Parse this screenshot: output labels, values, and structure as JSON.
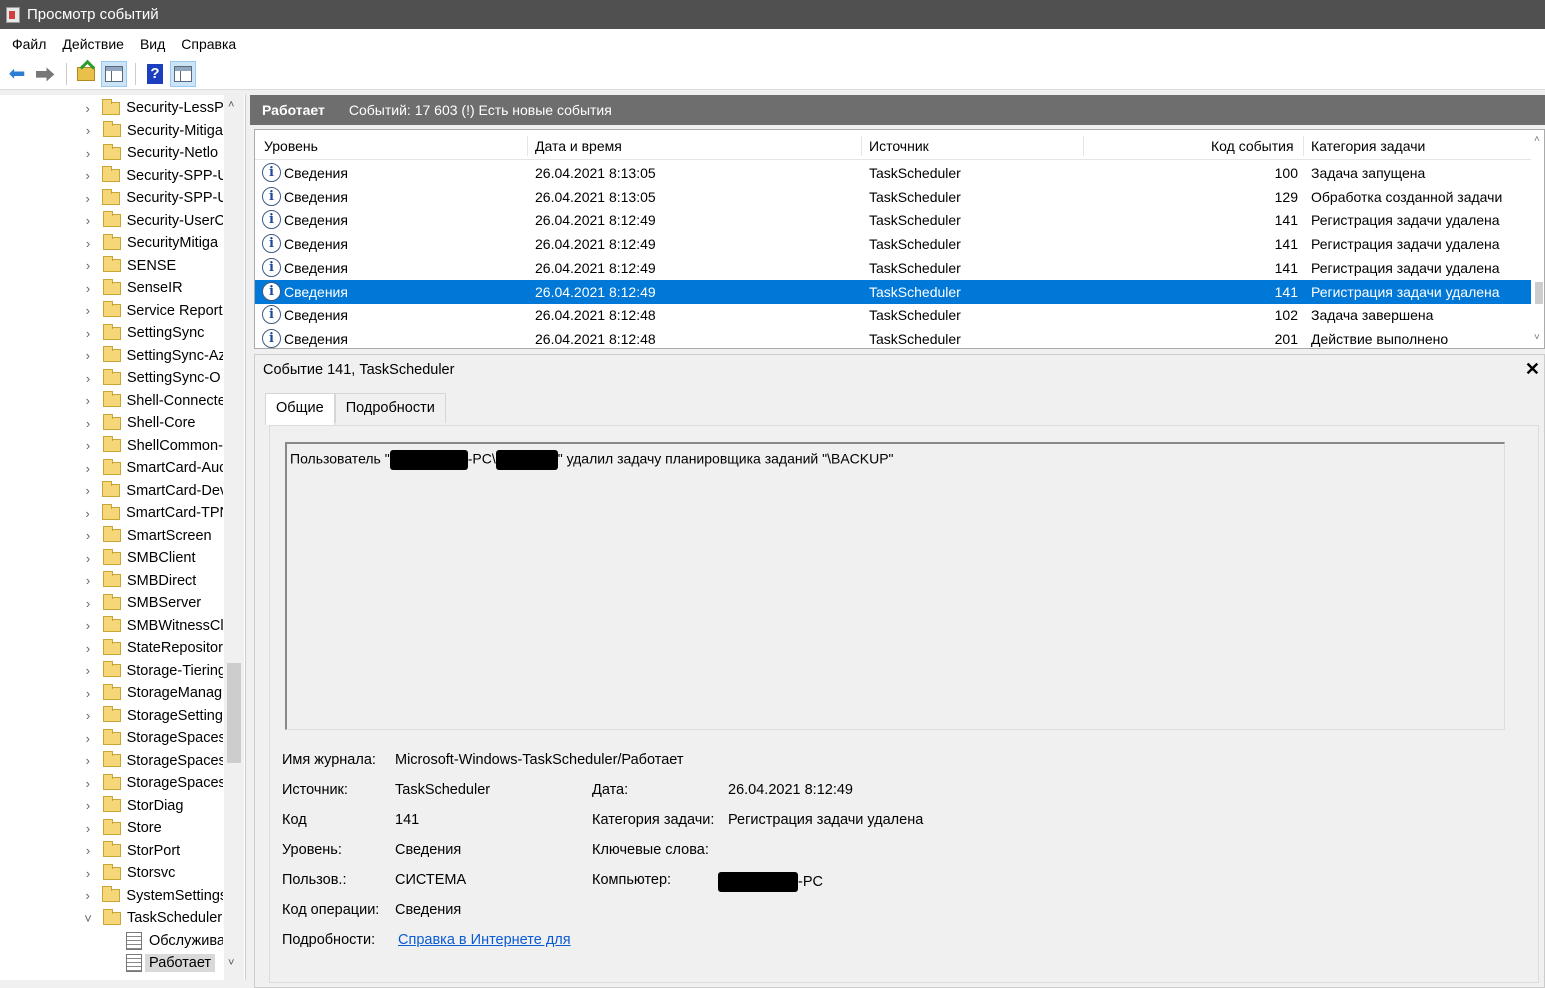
{
  "window": {
    "title": "Просмотр событий"
  },
  "menu": [
    "Файл",
    "Действие",
    "Вид",
    "Справка"
  ],
  "toolbar": [
    "back-arrow-icon",
    "forward-arrow-icon",
    "up-folder-icon",
    "console-tree-icon",
    "help-icon",
    "action-pane-icon"
  ],
  "tree": {
    "folders": [
      "Security-LessPr",
      "Security-Mitiga",
      "Security-Netlo",
      "Security-SPP-U",
      "Security-SPP-U",
      "Security-UserC",
      "SecurityMitiga",
      "SENSE",
      "SenseIR",
      "Service Reporti",
      "SettingSync",
      "SettingSync-Az",
      "SettingSync-O",
      "Shell-Connecte",
      "Shell-Core",
      "ShellCommon-",
      "SmartCard-Auc",
      "SmartCard-Dev",
      "SmartCard-TPN",
      "SmartScreen",
      "SMBClient",
      "SMBDirect",
      "SMBServer",
      "SMBWitnessCl",
      "StateRepositor",
      "Storage-Tiering",
      "StorageManag",
      "StorageSetting",
      "StorageSpaces",
      "StorageSpaces",
      "StorageSpaces",
      "StorDiag",
      "Store",
      "StorPort",
      "Storsvc",
      "SystemSettings",
      "TaskScheduler"
    ],
    "logs": [
      "Обслужива",
      "Работает"
    ]
  },
  "log_header": {
    "name": "Работает",
    "info": "Событий: 17 603 (!) Есть новые события"
  },
  "columns": {
    "level": "Уровень",
    "datetime": "Дата и время",
    "source": "Источник",
    "event_id": "Код события",
    "category": "Категория задачи"
  },
  "rows": [
    {
      "level": "Сведения",
      "datetime": "26.04.2021 8:13:05",
      "source": "TaskScheduler",
      "event_id": "100",
      "category": "Задача запущена"
    },
    {
      "level": "Сведения",
      "datetime": "26.04.2021 8:13:05",
      "source": "TaskScheduler",
      "event_id": "129",
      "category": "Обработка созданной задачи"
    },
    {
      "level": "Сведения",
      "datetime": "26.04.2021 8:12:49",
      "source": "TaskScheduler",
      "event_id": "141",
      "category": "Регистрация задачи удалена"
    },
    {
      "level": "Сведения",
      "datetime": "26.04.2021 8:12:49",
      "source": "TaskScheduler",
      "event_id": "141",
      "category": "Регистрация задачи удалена"
    },
    {
      "level": "Сведения",
      "datetime": "26.04.2021 8:12:49",
      "source": "TaskScheduler",
      "event_id": "141",
      "category": "Регистрация задачи удалена"
    },
    {
      "level": "Сведения",
      "datetime": "26.04.2021 8:12:49",
      "source": "TaskScheduler",
      "event_id": "141",
      "category": "Регистрация задачи удалена"
    },
    {
      "level": "Сведения",
      "datetime": "26.04.2021 8:12:48",
      "source": "TaskScheduler",
      "event_id": "102",
      "category": "Задача завершена"
    },
    {
      "level": "Сведения",
      "datetime": "26.04.2021 8:12:48",
      "source": "TaskScheduler",
      "event_id": "201",
      "category": "Действие выполнено"
    }
  ],
  "detail": {
    "title": "Событие 141, TaskScheduler",
    "tabs": [
      "Общие",
      "Подробности"
    ],
    "message": {
      "p1": "Пользователь \"",
      "p2": "-PC\\",
      "p3": "\" удалил задачу планировщика заданий \"\\BACKUP\""
    },
    "labels": {
      "log": "Имя журнала:",
      "source": "Источник:",
      "code": "Код",
      "level": "Уровень:",
      "user": "Пользов.:",
      "opcode": "Код операции:",
      "more": "Подробности:",
      "date": "Дата:",
      "category": "Категория задачи:",
      "keywords": "Ключевые слова:",
      "computer": "Компьютер:"
    },
    "values": {
      "log": "Microsoft-Windows-TaskScheduler/Работает",
      "source": "TaskScheduler",
      "code": "141",
      "level": "Сведения",
      "user": "СИСТЕМА",
      "opcode": "Сведения",
      "more": "Справка в Интернете для",
      "date": "26.04.2021 8:12:49",
      "category": "Регистрация задачи удалена",
      "keywords": "",
      "computer": "-PC"
    }
  }
}
